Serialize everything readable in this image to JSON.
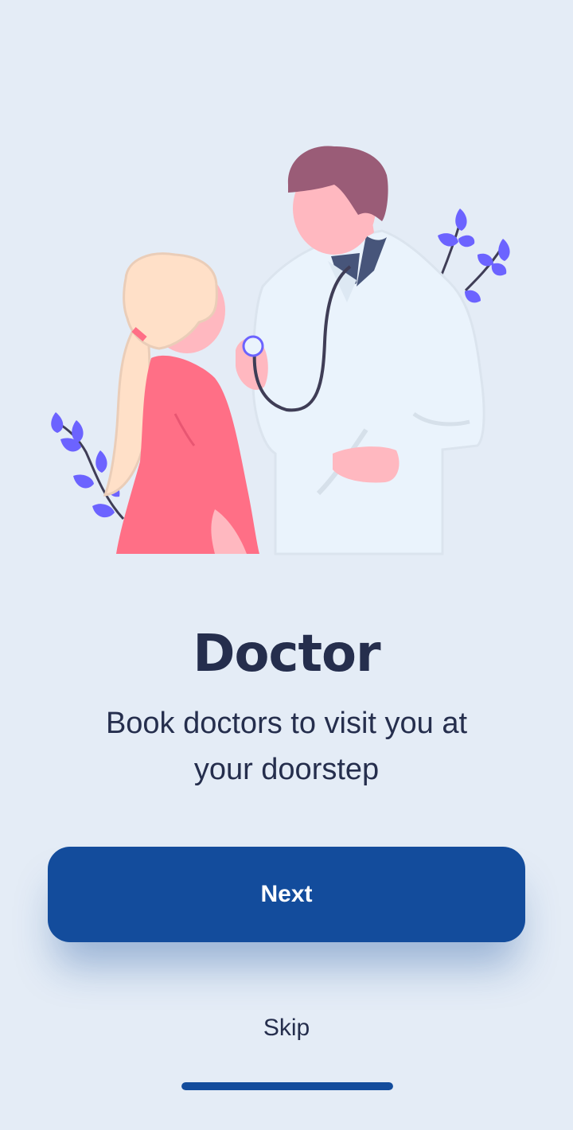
{
  "onboarding": {
    "illustration_icon": "doctor-examining-patient-illustration",
    "title": "Doctor",
    "subtitle": "Book doctors to visit you at your doorstep",
    "next_label": "Next",
    "skip_label": "Skip",
    "progress": 1.0
  },
  "colors": {
    "background": "#e4ecf6",
    "primary": "#134c9c",
    "text": "#252e4d",
    "leaf_accent": "#6c63ff",
    "patient_shirt": "#ff6f86",
    "doctor_hair": "#9a5c77"
  }
}
